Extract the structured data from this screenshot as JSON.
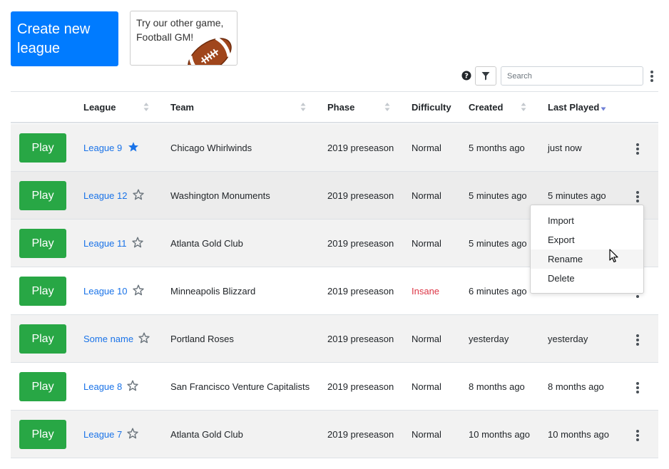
{
  "create_button": {
    "label_line1": "Create new",
    "label_line2": "league"
  },
  "promo": {
    "line1": "Try our other game,",
    "line2": "Football GM!",
    "icon": "football-icon"
  },
  "toolbar": {
    "search_placeholder": "Search",
    "help_icon": "question-circle-icon",
    "filter_icon": "filter-icon"
  },
  "columns": [
    "League",
    "Team",
    "Phase",
    "Difficulty",
    "Created",
    "Last Played"
  ],
  "sort": {
    "column": "Last Played",
    "direction": "desc"
  },
  "play_label": "Play",
  "rows": [
    {
      "league": "League 9",
      "starred": true,
      "team": "Chicago Whirlwinds",
      "phase": "2019 preseason",
      "difficulty": "Normal",
      "created": "5 months ago",
      "last_played": "just now"
    },
    {
      "league": "League 12",
      "starred": false,
      "team": "Washington Monuments",
      "phase": "2019 preseason",
      "difficulty": "Normal",
      "created": "5 minutes ago",
      "last_played": "5 minutes ago"
    },
    {
      "league": "League 11",
      "starred": false,
      "team": "Atlanta Gold Club",
      "phase": "2019 preseason",
      "difficulty": "Normal",
      "created": "5 minutes ago",
      "last_played": ""
    },
    {
      "league": "League 10",
      "starred": false,
      "team": "Minneapolis Blizzard",
      "phase": "2019 preseason",
      "difficulty": "Insane",
      "created": "6 minutes ago",
      "last_played": ""
    },
    {
      "league": "Some name",
      "starred": false,
      "team": "Portland Roses",
      "phase": "2019 preseason",
      "difficulty": "Normal",
      "created": "yesterday",
      "last_played": "yesterday"
    },
    {
      "league": "League 8",
      "starred": false,
      "team": "San Francisco Venture Capitalists",
      "phase": "2019 preseason",
      "difficulty": "Normal",
      "created": "8 months ago",
      "last_played": "8 months ago"
    },
    {
      "league": "League 7",
      "starred": false,
      "team": "Atlanta Gold Club",
      "phase": "2019 preseason",
      "difficulty": "Normal",
      "created": "10 months ago",
      "last_played": "10 months ago"
    }
  ],
  "context_menu": {
    "items": [
      "Import",
      "Export",
      "Rename",
      "Delete"
    ],
    "highlighted": "Rename"
  },
  "colors": {
    "primary": "#007bff",
    "play": "#28a745",
    "link": "#1a73e8",
    "insane": "#dc3545",
    "star_filled": "#1a73e8"
  }
}
